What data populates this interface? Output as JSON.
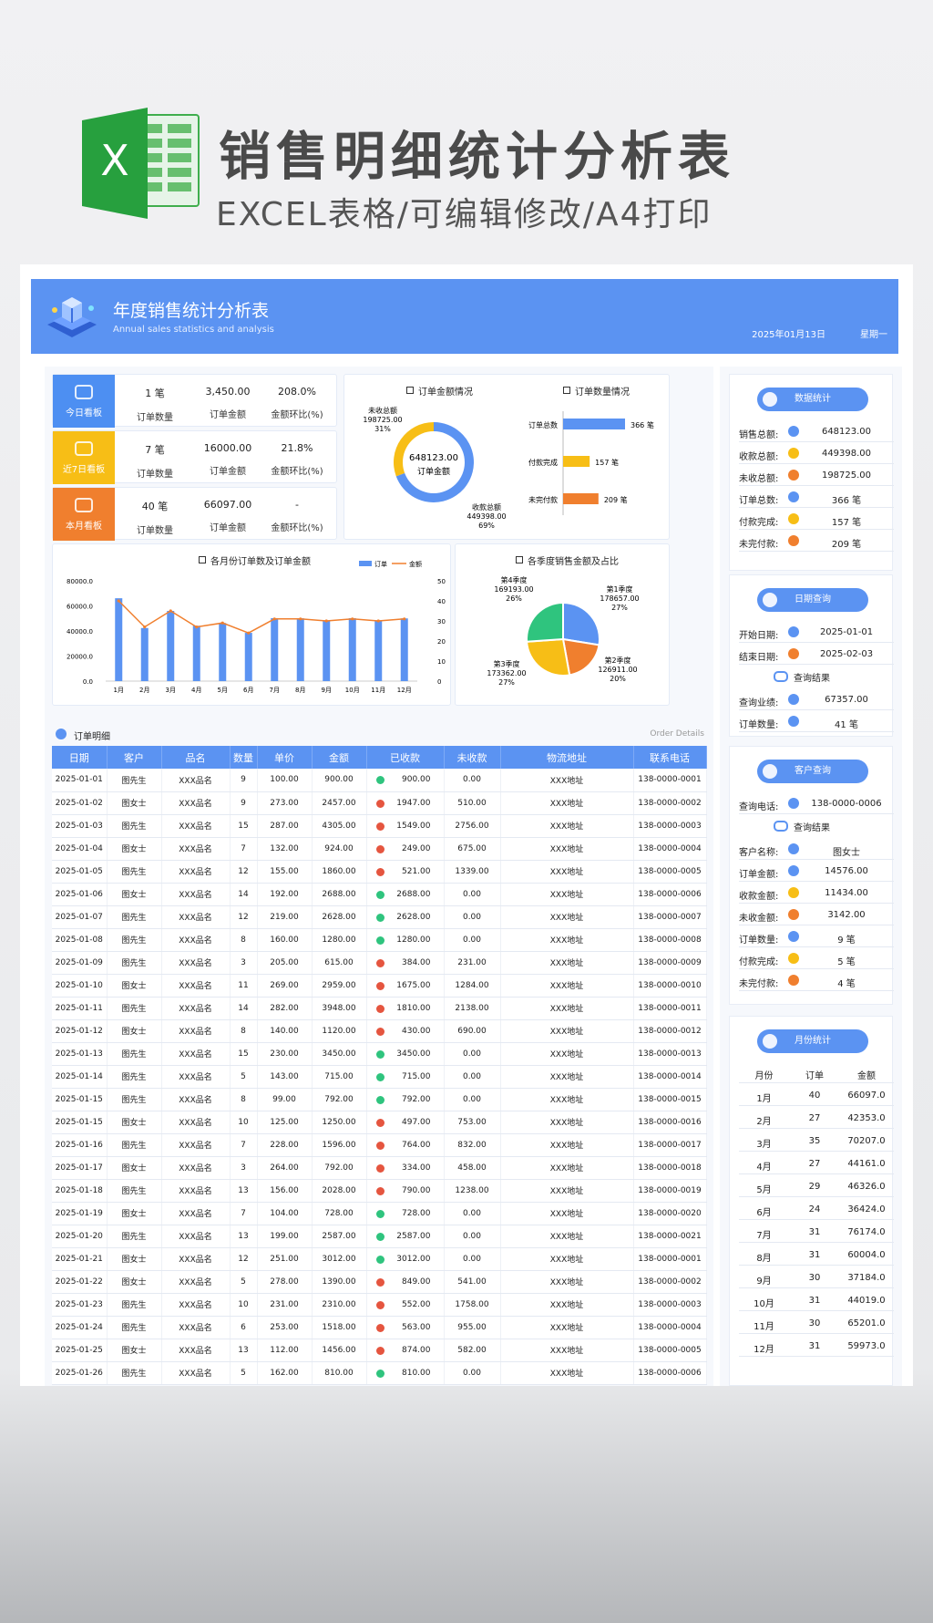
{
  "promo": {
    "icon_letter": "X",
    "title": "销售明细统计分析表",
    "subtitle": "EXCEL表格/可编辑修改/A4打印"
  },
  "header": {
    "title": "年度销售统计分析表",
    "subtitle_en": "Annual sales statistics and analysis",
    "date": "2025年01月13日",
    "weekday": "星期一"
  },
  "kpis": [
    {
      "tag": "今日看板",
      "color": "#4d8ff2",
      "count": "1 笔",
      "count_label": "订单数量",
      "amount": "3,450.00",
      "amount_label": "订单金额",
      "ratio": "208.0%",
      "ratio_label": "金额环比(%)"
    },
    {
      "tag": "近7日看板",
      "color": "#f7be16",
      "count": "7 笔",
      "count_label": "订单数量",
      "amount": "16000.00",
      "amount_label": "订单金额",
      "ratio": "21.8%",
      "ratio_label": "金额环比(%)"
    },
    {
      "tag": "本月看板",
      "color": "#f07f2e",
      "count": "40 笔",
      "count_label": "订单数量",
      "amount": "66097.00",
      "amount_label": "订单金额",
      "ratio": "-",
      "ratio_label": "金额环比(%)"
    }
  ],
  "colors": {
    "blue": "#5b93f2",
    "yellow": "#f7be16",
    "orange": "#f07f2e",
    "green": "#2fc47e",
    "red": "#e5553f"
  },
  "chart_data": [
    {
      "type": "pie",
      "title": "订单金额情况",
      "center_value": "648123.00",
      "center_label": "订单金额",
      "slices": [
        {
          "name": "收款总额",
          "value": 449398.0,
          "label": "449398.00",
          "pct": "69%"
        },
        {
          "name": "未收总额",
          "value": 198725.0,
          "label": "198725.00",
          "pct": "31%"
        }
      ]
    },
    {
      "type": "bar",
      "title": "订单数量情况",
      "categories": [
        "订单总数",
        "付款完成",
        "未完付款"
      ],
      "values": [
        366,
        157,
        209
      ],
      "value_labels": [
        "366 笔",
        "157 笔",
        "209 笔"
      ],
      "xlim": [
        0,
        366
      ]
    },
    {
      "type": "bar",
      "title": "各月份订单数及订单金额",
      "categories": [
        "1月",
        "2月",
        "3月",
        "4月",
        "5月",
        "6月",
        "7月",
        "8月",
        "9月",
        "10月",
        "11月",
        "12月"
      ],
      "series": [
        {
          "name": "订单",
          "type": "bar",
          "axis": "left",
          "values": [
            66097,
            42353,
            56000,
            44161,
            46326,
            38500,
            50200,
            50100,
            48200,
            50200,
            48400,
            50000
          ]
        },
        {
          "name": "金额",
          "type": "line",
          "axis": "right",
          "values": [
            40,
            27,
            35,
            27,
            29,
            24,
            31,
            31,
            30,
            31,
            30,
            31
          ]
        }
      ],
      "ylim": [
        0,
        80000
      ],
      "y_ticks": [
        "0.0",
        "20000.0",
        "40000.0",
        "60000.0",
        "80000.0"
      ],
      "y2lim": [
        0,
        50
      ],
      "y2_ticks": [
        "0",
        "10",
        "20",
        "30",
        "40",
        "50"
      ]
    },
    {
      "type": "pie",
      "title": "各季度销售金额及占比",
      "slices": [
        {
          "name": "第1季度",
          "value": 178657.0,
          "label": "178657.00",
          "pct": "27%"
        },
        {
          "name": "第2季度",
          "value": 126911.0,
          "label": "126911.00",
          "pct": "20%"
        },
        {
          "name": "第3季度",
          "value": 173362.0,
          "label": "173362.00",
          "pct": "27%"
        },
        {
          "name": "第4季度",
          "value": 169193.0,
          "label": "169193.00",
          "pct": "26%"
        }
      ]
    }
  ],
  "detail": {
    "title": "订单明细",
    "title_en": "Order Details",
    "columns": [
      "日期",
      "客户",
      "品名",
      "数量",
      "单价",
      "金额",
      "已收款",
      "未收款",
      "物流地址",
      "联系电话"
    ],
    "rows": [
      {
        "date": "2025-01-01",
        "customer": "图先生",
        "product": "XXX品名",
        "qty": "9",
        "price": "100.00",
        "amount": "900.00",
        "paid_ok": true,
        "received": "900.00",
        "unpaid": "0.00",
        "address": "XXX地址",
        "phone": "138-0000-0001"
      },
      {
        "date": "2025-01-02",
        "customer": "图女士",
        "product": "XXX品名",
        "qty": "9",
        "price": "273.00",
        "amount": "2457.00",
        "paid_ok": false,
        "received": "1947.00",
        "unpaid": "510.00",
        "address": "XXX地址",
        "phone": "138-0000-0002"
      },
      {
        "date": "2025-01-03",
        "customer": "图先生",
        "product": "XXX品名",
        "qty": "15",
        "price": "287.00",
        "amount": "4305.00",
        "paid_ok": false,
        "received": "1549.00",
        "unpaid": "2756.00",
        "address": "XXX地址",
        "phone": "138-0000-0003"
      },
      {
        "date": "2025-01-04",
        "customer": "图女士",
        "product": "XXX品名",
        "qty": "7",
        "price": "132.00",
        "amount": "924.00",
        "paid_ok": false,
        "received": "249.00",
        "unpaid": "675.00",
        "address": "XXX地址",
        "phone": "138-0000-0004"
      },
      {
        "date": "2025-01-05",
        "customer": "图先生",
        "product": "XXX品名",
        "qty": "12",
        "price": "155.00",
        "amount": "1860.00",
        "paid_ok": false,
        "received": "521.00",
        "unpaid": "1339.00",
        "address": "XXX地址",
        "phone": "138-0000-0005"
      },
      {
        "date": "2025-01-06",
        "customer": "图女士",
        "product": "XXX品名",
        "qty": "14",
        "price": "192.00",
        "amount": "2688.00",
        "paid_ok": true,
        "received": "2688.00",
        "unpaid": "0.00",
        "address": "XXX地址",
        "phone": "138-0000-0006"
      },
      {
        "date": "2025-01-07",
        "customer": "图先生",
        "product": "XXX品名",
        "qty": "12",
        "price": "219.00",
        "amount": "2628.00",
        "paid_ok": true,
        "received": "2628.00",
        "unpaid": "0.00",
        "address": "XXX地址",
        "phone": "138-0000-0007"
      },
      {
        "date": "2025-01-08",
        "customer": "图先生",
        "product": "XXX品名",
        "qty": "8",
        "price": "160.00",
        "amount": "1280.00",
        "paid_ok": true,
        "received": "1280.00",
        "unpaid": "0.00",
        "address": "XXX地址",
        "phone": "138-0000-0008"
      },
      {
        "date": "2025-01-09",
        "customer": "图先生",
        "product": "XXX品名",
        "qty": "3",
        "price": "205.00",
        "amount": "615.00",
        "paid_ok": false,
        "received": "384.00",
        "unpaid": "231.00",
        "address": "XXX地址",
        "phone": "138-0000-0009"
      },
      {
        "date": "2025-01-10",
        "customer": "图女士",
        "product": "XXX品名",
        "qty": "11",
        "price": "269.00",
        "amount": "2959.00",
        "paid_ok": false,
        "received": "1675.00",
        "unpaid": "1284.00",
        "address": "XXX地址",
        "phone": "138-0000-0010"
      },
      {
        "date": "2025-01-11",
        "customer": "图先生",
        "product": "XXX品名",
        "qty": "14",
        "price": "282.00",
        "amount": "3948.00",
        "paid_ok": false,
        "received": "1810.00",
        "unpaid": "2138.00",
        "address": "XXX地址",
        "phone": "138-0000-0011"
      },
      {
        "date": "2025-01-12",
        "customer": "图女士",
        "product": "XXX品名",
        "qty": "8",
        "price": "140.00",
        "amount": "1120.00",
        "paid_ok": false,
        "received": "430.00",
        "unpaid": "690.00",
        "address": "XXX地址",
        "phone": "138-0000-0012"
      },
      {
        "date": "2025-01-13",
        "customer": "图先生",
        "product": "XXX品名",
        "qty": "15",
        "price": "230.00",
        "amount": "3450.00",
        "paid_ok": true,
        "received": "3450.00",
        "unpaid": "0.00",
        "address": "XXX地址",
        "phone": "138-0000-0013"
      },
      {
        "date": "2025-01-14",
        "customer": "图先生",
        "product": "XXX品名",
        "qty": "5",
        "price": "143.00",
        "amount": "715.00",
        "paid_ok": true,
        "received": "715.00",
        "unpaid": "0.00",
        "address": "XXX地址",
        "phone": "138-0000-0014"
      },
      {
        "date": "2025-01-15",
        "customer": "图先生",
        "product": "XXX品名",
        "qty": "8",
        "price": "99.00",
        "amount": "792.00",
        "paid_ok": true,
        "received": "792.00",
        "unpaid": "0.00",
        "address": "XXX地址",
        "phone": "138-0000-0015"
      },
      {
        "date": "2025-01-15",
        "customer": "图女士",
        "product": "XXX品名",
        "qty": "10",
        "price": "125.00",
        "amount": "1250.00",
        "paid_ok": false,
        "received": "497.00",
        "unpaid": "753.00",
        "address": "XXX地址",
        "phone": "138-0000-0016"
      },
      {
        "date": "2025-01-16",
        "customer": "图先生",
        "product": "XXX品名",
        "qty": "7",
        "price": "228.00",
        "amount": "1596.00",
        "paid_ok": false,
        "received": "764.00",
        "unpaid": "832.00",
        "address": "XXX地址",
        "phone": "138-0000-0017"
      },
      {
        "date": "2025-01-17",
        "customer": "图女士",
        "product": "XXX品名",
        "qty": "3",
        "price": "264.00",
        "amount": "792.00",
        "paid_ok": false,
        "received": "334.00",
        "unpaid": "458.00",
        "address": "XXX地址",
        "phone": "138-0000-0018"
      },
      {
        "date": "2025-01-18",
        "customer": "图先生",
        "product": "XXX品名",
        "qty": "13",
        "price": "156.00",
        "amount": "2028.00",
        "paid_ok": false,
        "received": "790.00",
        "unpaid": "1238.00",
        "address": "XXX地址",
        "phone": "138-0000-0019"
      },
      {
        "date": "2025-01-19",
        "customer": "图女士",
        "product": "XXX品名",
        "qty": "7",
        "price": "104.00",
        "amount": "728.00",
        "paid_ok": true,
        "received": "728.00",
        "unpaid": "0.00",
        "address": "XXX地址",
        "phone": "138-0000-0020"
      },
      {
        "date": "2025-01-20",
        "customer": "图先生",
        "product": "XXX品名",
        "qty": "13",
        "price": "199.00",
        "amount": "2587.00",
        "paid_ok": true,
        "received": "2587.00",
        "unpaid": "0.00",
        "address": "XXX地址",
        "phone": "138-0000-0021"
      },
      {
        "date": "2025-01-21",
        "customer": "图女士",
        "product": "XXX品名",
        "qty": "12",
        "price": "251.00",
        "amount": "3012.00",
        "paid_ok": true,
        "received": "3012.00",
        "unpaid": "0.00",
        "address": "XXX地址",
        "phone": "138-0000-0001"
      },
      {
        "date": "2025-01-22",
        "customer": "图女士",
        "product": "XXX品名",
        "qty": "5",
        "price": "278.00",
        "amount": "1390.00",
        "paid_ok": false,
        "received": "849.00",
        "unpaid": "541.00",
        "address": "XXX地址",
        "phone": "138-0000-0002"
      },
      {
        "date": "2025-01-23",
        "customer": "图先生",
        "product": "XXX品名",
        "qty": "10",
        "price": "231.00",
        "amount": "2310.00",
        "paid_ok": false,
        "received": "552.00",
        "unpaid": "1758.00",
        "address": "XXX地址",
        "phone": "138-0000-0003"
      },
      {
        "date": "2025-01-24",
        "customer": "图先生",
        "product": "XXX品名",
        "qty": "6",
        "price": "253.00",
        "amount": "1518.00",
        "paid_ok": false,
        "received": "563.00",
        "unpaid": "955.00",
        "address": "XXX地址",
        "phone": "138-0000-0004"
      },
      {
        "date": "2025-01-25",
        "customer": "图女士",
        "product": "XXX品名",
        "qty": "13",
        "price": "112.00",
        "amount": "1456.00",
        "paid_ok": false,
        "received": "874.00",
        "unpaid": "582.00",
        "address": "XXX地址",
        "phone": "138-0000-0005"
      },
      {
        "date": "2025-01-26",
        "customer": "图先生",
        "product": "XXX品名",
        "qty": "5",
        "price": "162.00",
        "amount": "810.00",
        "paid_ok": true,
        "received": "810.00",
        "unpaid": "0.00",
        "address": "XXX地址",
        "phone": "138-0000-0006"
      }
    ]
  },
  "sidebar": {
    "stats": {
      "title": "数据统计",
      "rows": [
        {
          "label": "销售总额:",
          "value": "648123.00",
          "color": "#5b93f2"
        },
        {
          "label": "收款总额:",
          "value": "449398.00",
          "color": "#f7be16"
        },
        {
          "label": "未收总额:",
          "value": "198725.00",
          "color": "#f07f2e"
        },
        {
          "label": "订单总数:",
          "value": "366 笔",
          "color": "#5b93f2"
        },
        {
          "label": "付款完成:",
          "value": "157 笔",
          "color": "#f7be16"
        },
        {
          "label": "未完付款:",
          "value": "209 笔",
          "color": "#f07f2e"
        }
      ]
    },
    "date_query": {
      "title": "日期查询",
      "start_label": "开始日期:",
      "start_value": "2025-01-01",
      "end_label": "结束日期:",
      "end_value": "2025-02-03",
      "result_title": "查询结果",
      "results": [
        {
          "label": "查询业绩:",
          "value": "67357.00"
        },
        {
          "label": "订单数量:",
          "value": "41 笔"
        }
      ]
    },
    "customer_query": {
      "title": "客户查询",
      "phone_label": "查询电话:",
      "phone_value": "138-0000-0006",
      "result_title": "查询结果",
      "rows": [
        {
          "label": "客户名称:",
          "value": "图女士",
          "color": "#5b93f2"
        },
        {
          "label": "订单金额:",
          "value": "14576.00",
          "color": "#5b93f2"
        },
        {
          "label": "收款金额:",
          "value": "11434.00",
          "color": "#f7be16"
        },
        {
          "label": "未收金额:",
          "value": "3142.00",
          "color": "#f07f2e"
        },
        {
          "label": "订单数量:",
          "value": "9 笔",
          "color": "#5b93f2"
        },
        {
          "label": "付款完成:",
          "value": "5 笔",
          "color": "#f7be16"
        },
        {
          "label": "未完付款:",
          "value": "4 笔",
          "color": "#f07f2e"
        }
      ]
    },
    "monthly": {
      "title": "月份统计",
      "headers": [
        "月份",
        "订单",
        "金额"
      ],
      "rows": [
        {
          "month": "1月",
          "orders": "40",
          "amount": "66097.0"
        },
        {
          "month": "2月",
          "orders": "27",
          "amount": "42353.0"
        },
        {
          "month": "3月",
          "orders": "35",
          "amount": "70207.0"
        },
        {
          "month": "4月",
          "orders": "27",
          "amount": "44161.0"
        },
        {
          "month": "5月",
          "orders": "29",
          "amount": "46326.0"
        },
        {
          "month": "6月",
          "orders": "24",
          "amount": "36424.0"
        },
        {
          "month": "7月",
          "orders": "31",
          "amount": "76174.0"
        },
        {
          "month": "8月",
          "orders": "31",
          "amount": "60004.0"
        },
        {
          "month": "9月",
          "orders": "30",
          "amount": "37184.0"
        },
        {
          "month": "10月",
          "orders": "31",
          "amount": "44019.0"
        },
        {
          "month": "11月",
          "orders": "30",
          "amount": "65201.0"
        },
        {
          "month": "12月",
          "orders": "31",
          "amount": "59973.0"
        }
      ]
    }
  }
}
